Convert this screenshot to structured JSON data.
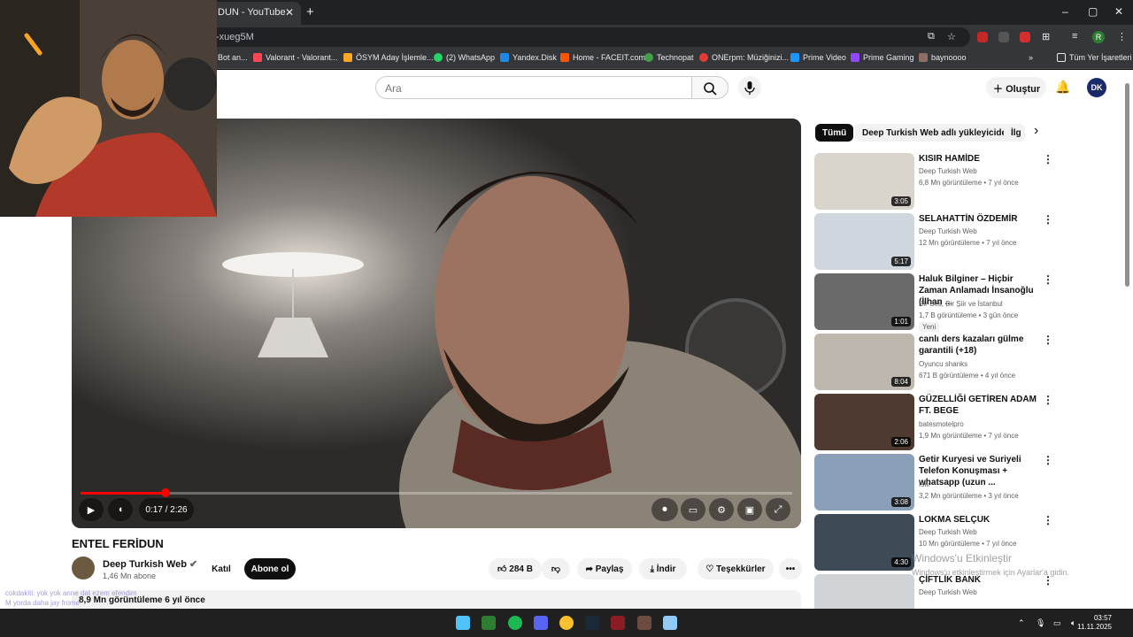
{
  "browser": {
    "tab_title": "DUN - YouTube",
    "tab_close": "✕",
    "new_tab": "+",
    "url": "-xueg5M",
    "bookmarks": [
      "Bot an...",
      "Valorant - Valorant...",
      "ÖSYM Aday İşlemle...",
      "(2) WhatsApp",
      "Yandex.Disk",
      "Home - FACEIT.com",
      "Technopat",
      "ONErpm: Müziğinizi...",
      "Prime Video",
      "Prime Gaming",
      "baynoooo"
    ],
    "bookmarks_more": "»",
    "all_bookmarks": "Tüm Yer İşaretleri",
    "profile_initial": "R",
    "win_min": "–",
    "win_max": "▢",
    "win_close": "✕"
  },
  "youtube": {
    "search_placeholder": "Ara",
    "create_label": "Oluştur",
    "avatar_text": "DK",
    "video": {
      "title": "ENTEL FERİDUN",
      "time": "0:17 / 2:26",
      "progress": 0.12,
      "channel": "Deep Turkish Web",
      "subscribers": "1,46 Mn abone",
      "join": "Katıl",
      "subscribe": "Abone ol",
      "likes": "284 B",
      "share": "Paylaş",
      "download": "İndir",
      "thanks": "Teşekkürler",
      "more": "•••",
      "views_meta": "8,9 Mn görüntüleme  6 yıl önce"
    },
    "chips": [
      "Tümü",
      "Deep Turkish Web adlı yükleyiciden",
      "İlg"
    ],
    "chips_next": "›",
    "recommendations": [
      {
        "title": "KISIR HAMİDE",
        "channel": "Deep Turkish Web",
        "meta": "6,8 Mn görüntüleme • 7 yıl önce",
        "duration": "3:05",
        "badge": ""
      },
      {
        "title": "SELAHATTİN ÖZDEMİR",
        "channel": "Deep Turkish Web",
        "meta": "12 Mn görüntüleme • 7 yıl önce",
        "duration": "5:17",
        "badge": ""
      },
      {
        "title": "Haluk Bilginer – Hiçbir Zaman Anlamadı İnsanoğlu (İlhan ...",
        "channel": "Bir Ses, Bir Şiir ve İstanbul",
        "meta": "1,7 B görüntüleme • 3 gün önce",
        "duration": "1:01",
        "badge": "Yeni"
      },
      {
        "title": "canlı ders kazaları gülme garantili (+18)",
        "channel": "Oyuncu shanks",
        "meta": "671 B görüntüleme • 4 yıl önce",
        "duration": "8:04",
        "badge": ""
      },
      {
        "title": "GÜZELLİĞİ GETİREN ADAM FT. BEGE",
        "channel": "batesmotelpro",
        "meta": "1,9 Mn görüntüleme • 7 yıl önce",
        "duration": "2:06",
        "badge": ""
      },
      {
        "title": "Getir Kuryesi ve Suriyeli Telefon Konuşması + whatsapp (uzun ...",
        "channel": "Isılr",
        "meta": "3,2 Mn görüntüleme • 3 yıl önce",
        "duration": "3:08",
        "badge": ""
      },
      {
        "title": "LOKMA SELÇUK",
        "channel": "Deep Turkish Web",
        "meta": "10 Mn görüntüleme • 7 yıl önce",
        "duration": "4:30",
        "badge": ""
      },
      {
        "title": "ÇİFTLİK BANK",
        "channel": "Deep Turkish Web",
        "meta": "",
        "duration": "",
        "badge": ""
      }
    ],
    "watermark_title": "Windows'u Etkinleştir",
    "watermark_sub": "Windows'u etkinleştirmek için Ayarlar'a gidin."
  },
  "chat": {
    "line1": "cokdakiti: yok yok anne dat ezem efendim",
    "line2": "M yorda daha jay frome"
  },
  "taskbar": {
    "time": "03:57",
    "date": "11.11.2025"
  }
}
